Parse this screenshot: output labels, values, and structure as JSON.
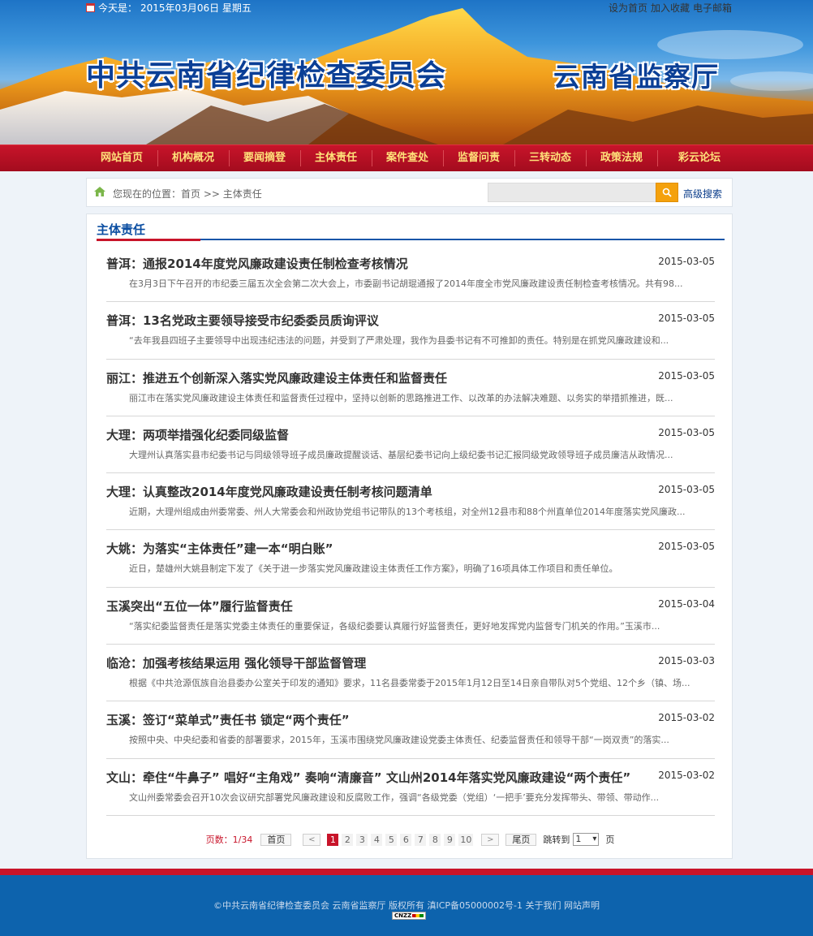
{
  "header": {
    "date_label": "今天是：",
    "date_value": "2015年03月06日 星期五",
    "links": [
      "设为首页",
      "加入收藏",
      "电子邮箱"
    ],
    "title_main": "中共云南省纪律检查委员会",
    "title_right": "云南省监察厅"
  },
  "nav": {
    "items": [
      "网站首页",
      "机构概况",
      "要闻摘登",
      "主体责任",
      "案件查处",
      "监督问责",
      "三转动态",
      "政策法规",
      "彩云论坛"
    ]
  },
  "breadcrumb": {
    "text": "您现在的位置：首页 >> 主体责任",
    "search_placeholder": "",
    "advanced_search": "高级搜索"
  },
  "section": {
    "title": "主体责任",
    "items": [
      {
        "title": "普洱：通报2014年度党风廉政建设责任制检查考核情况",
        "date": "2015-03-05",
        "desc": "在3月3日下午召开的市纪委三届五次全会第二次大会上，市委副书记胡琨通报了2014年度全市党风廉政建设责任制检查考核情况。共有98..."
      },
      {
        "title": "普洱：13名党政主要领导接受市纪委委员质询评议",
        "date": "2015-03-05",
        "desc": "“去年我县四班子主要领导中出现违纪违法的问题，并受到了严肃处理，我作为县委书记有不可推卸的责任。特别是在抓党风廉政建设和..."
      },
      {
        "title": "丽江：推进五个创新深入落实党风廉政建设主体责任和监督责任",
        "date": "2015-03-05",
        "desc": "丽江市在落实党风廉政建设主体责任和监督责任过程中，坚持以创新的思路推进工作、以改革的办法解决难题、以务实的举措抓推进，既..."
      },
      {
        "title": "大理：两项举措强化纪委同级监督",
        "date": "2015-03-05",
        "desc": "大理州认真落实县市纪委书记与同级领导班子成员廉政提醒谈话、基层纪委书记向上级纪委书记汇报同级党政领导班子成员廉洁从政情况..."
      },
      {
        "title": "大理：认真整改2014年度党风廉政建设责任制考核问题清单",
        "date": "2015-03-05",
        "desc": "近期，大理州组成由州委常委、州人大常委会和州政协党组书记带队的13个考核组，对全州12县市和88个州直单位2014年度落实党风廉政..."
      },
      {
        "title": "大姚：为落实“主体责任”建一本“明白账”",
        "date": "2015-03-05",
        "desc": "近日，楚雄州大姚县制定下发了《关于进一步落实党风廉政建设主体责任工作方案》，明确了16项具体工作项目和责任单位。"
      },
      {
        "title": "玉溪突出“五位一体”履行监督责任",
        "date": "2015-03-04",
        "desc": "“落实纪委监督责任是落实党委主体责任的重要保证，各级纪委要认真履行好监督责任，更好地发挥党内监督专门机关的作用。”玉溪市..."
      },
      {
        "title": "临沧：加强考核结果运用 强化领导干部监督管理",
        "date": "2015-03-03",
        "desc": "根据《中共沧源佤族自治县委办公室关于印发的通知》要求，11名县委常委于2015年1月12日至14日亲自带队对5个党组、12个乡（镇、场..."
      },
      {
        "title": "玉溪：签订“菜单式”责任书 锁定“两个责任”",
        "date": "2015-03-02",
        "desc": "按照中央、中央纪委和省委的部署要求，2015年，玉溪市围绕党风廉政建设党委主体责任、纪委监督责任和领导干部“一岗双责”的落实..."
      },
      {
        "title": "文山：牵住“牛鼻子” 唱好“主角戏” 奏响“清廉音” 文山州2014年落实党风廉政建设“两个责任”",
        "date": "2015-03-02",
        "desc": "文山州委常委会召开10次会议研究部署党风廉政建设和反腐败工作，强调“各级党委（党组）‘一把手’要充分发挥带头、带领、带动作..."
      }
    ]
  },
  "pager": {
    "count": "页数：1/34",
    "first": "首页",
    "prev_arrow": "<",
    "pages": [
      "1",
      "2",
      "3",
      "4",
      "5",
      "6",
      "7",
      "8",
      "9",
      "10"
    ],
    "next_arrow": ">",
    "last": "尾页",
    "jump_label": "跳转到",
    "jump_value": "1",
    "jump_suffix": "页"
  },
  "footer": {
    "text": "©中共云南省纪律检查委员会 云南省监察厅 版权所有 滇ICP备05000002号-1 关于我们 网站声明",
    "badge": "CNZZ"
  },
  "colors": {
    "nav_red": "#c8142a",
    "title_blue": "#0b3f96",
    "footer_blue": "#0d63ad",
    "search_orange": "#f4a10c"
  }
}
